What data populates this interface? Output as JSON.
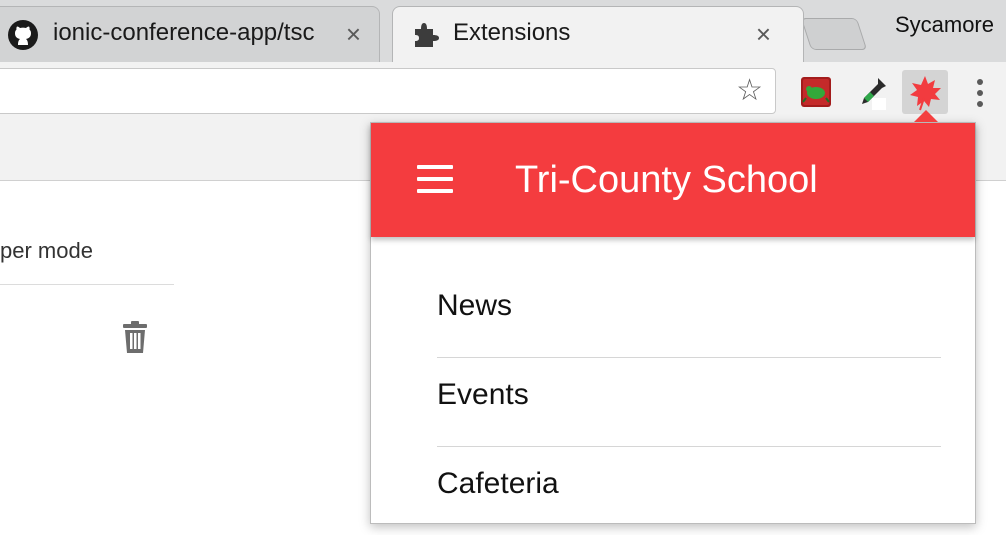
{
  "browser": {
    "tabs": [
      {
        "label": "ionic-conference-app/tsc",
        "icon": "github-icon",
        "active": false
      },
      {
        "label": "Extensions",
        "icon": "puzzle-piece-icon",
        "active": true
      }
    ],
    "close_glyph": "×",
    "profile_name": "Sycamore",
    "bookmark_glyph": "☆"
  },
  "extensions_page": {
    "dev_mode_label": "per mode",
    "trash_icon": "trash-icon"
  },
  "popup": {
    "title": "Tri-County School",
    "header_color": "#f43c3f",
    "menu_icon": "hamburger-icon",
    "nav_items": [
      {
        "label": "News"
      },
      {
        "label": "Events"
      },
      {
        "label": "Cafeteria"
      }
    ]
  }
}
